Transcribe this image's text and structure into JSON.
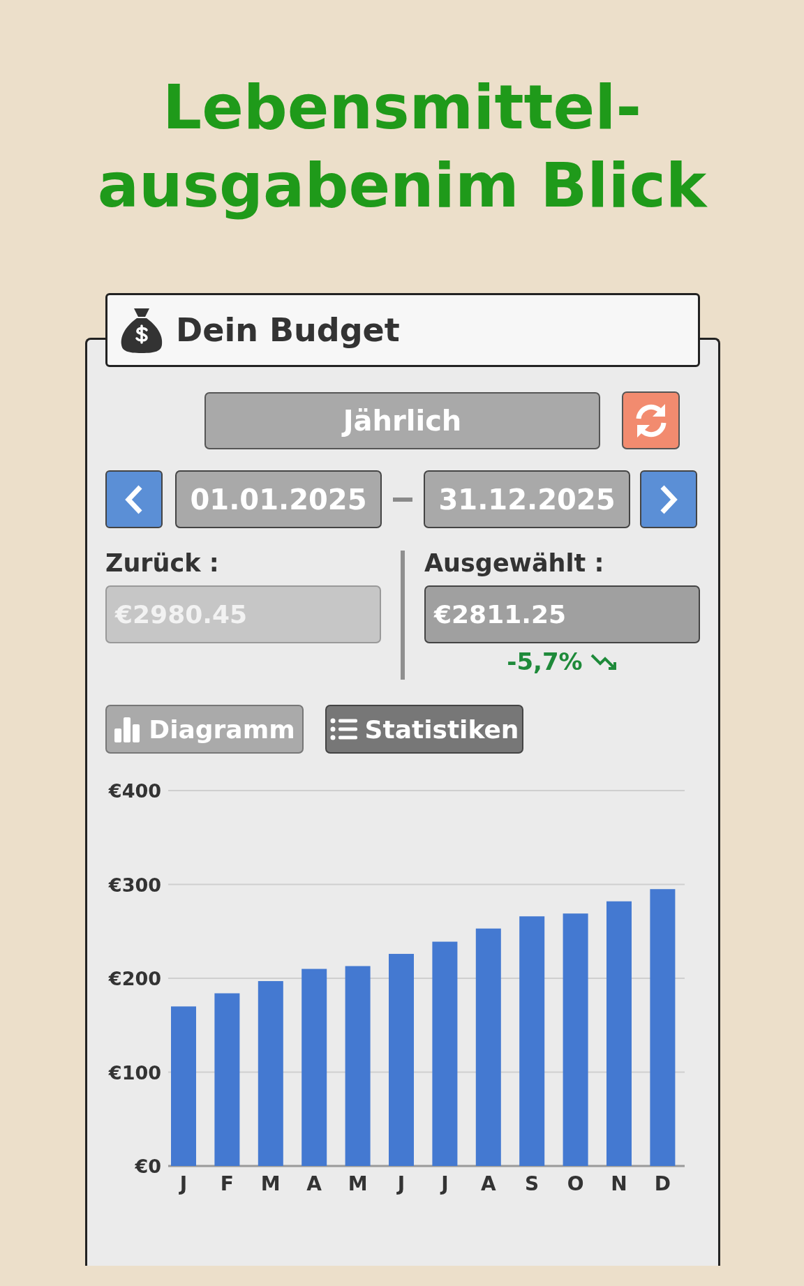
{
  "title_lines": [
    "Lebensmittel-",
    "ausgabenim Blick"
  ],
  "header": {
    "title": "Dein Budget"
  },
  "period": {
    "label": "Jährlich"
  },
  "date_range": {
    "start": "01.01.2025",
    "end": "31.12.2025"
  },
  "previous": {
    "label": "Zurück :",
    "value": "€2980.45"
  },
  "current": {
    "label": "Ausgewählt :",
    "value": "€2811.25",
    "change": "-5,7%",
    "trend_down": true
  },
  "view_tabs": [
    {
      "label": "Diagramm",
      "kind": "chart",
      "selected": true
    },
    {
      "label": "Statistiken",
      "kind": "list",
      "selected": false
    }
  ],
  "chart": {
    "chart_data": {
      "type": "bar",
      "categories": [
        "J",
        "F",
        "M",
        "A",
        "M",
        "J",
        "J",
        "A",
        "S",
        "O",
        "N",
        "D"
      ],
      "grid": true,
      "series": [
        {
          "color": "#4479d1",
          "values": [
            170,
            184,
            197,
            210,
            213,
            226,
            239,
            253,
            266,
            269,
            282,
            295
          ]
        }
      ],
      "ylim": [
        0,
        400
      ],
      "yticks": [
        {
          "value": 0,
          "label": "€0"
        },
        {
          "value": 100,
          "label": "€100"
        },
        {
          "value": 200,
          "label": "€200"
        },
        {
          "value": 300,
          "label": "€300"
        },
        {
          "value": 400,
          "label": "€400"
        }
      ]
    }
  }
}
